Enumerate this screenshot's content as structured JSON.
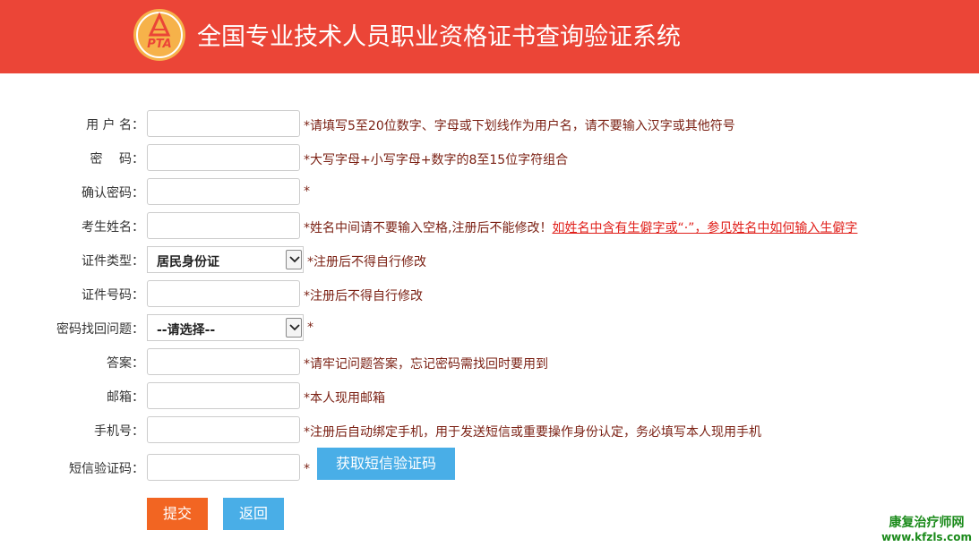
{
  "header": {
    "logo_text": "PTA",
    "title": "全国专业技术人员职业资格证书查询验证系统",
    "bg_color": "#eb4537"
  },
  "form": {
    "username": {
      "label": "用 户 名：",
      "value": "",
      "hint": "*请填写5至20位数字、字母或下划线作为用户名，请不要输入汉字或其他符号"
    },
    "password": {
      "label": "密　 码：",
      "value": "",
      "hint": "*大写字母+小写字母+数字的8至15位字符组合"
    },
    "confirm_password": {
      "label": "确认密码：",
      "value": "",
      "hint": "*"
    },
    "name": {
      "label": "考生姓名：",
      "value": "",
      "hint": "*姓名中间请不要输入空格,注册后不能修改！",
      "hint_link": "如姓名中含有生僻字或“·”，参见姓名中如何输入生僻字"
    },
    "id_type": {
      "label": "证件类型：",
      "selected": "居民身份证",
      "hint": "*注册后不得自行修改"
    },
    "id_number": {
      "label": "证件号码：",
      "value": "",
      "hint": "*注册后不得自行修改"
    },
    "security_question": {
      "label": "密码找回问题：",
      "selected": "--请选择--",
      "hint": "*"
    },
    "answer": {
      "label": "答案：",
      "value": "",
      "hint": "*请牢记问题答案，忘记密码需找回时要用到"
    },
    "email": {
      "label": "邮箱：",
      "value": "",
      "hint": "*本人现用邮箱"
    },
    "phone": {
      "label": "手机号：",
      "value": "",
      "hint": "*注册后自动绑定手机，用于发送短信或重要操作身份认定，务必填写本人现用手机"
    },
    "sms_code": {
      "label": "短信验证码：",
      "value": "",
      "hint": "*",
      "button": "获取短信验证码"
    }
  },
  "actions": {
    "submit": "提交",
    "back": "返回"
  },
  "watermark": {
    "cn": "康复治疗师网",
    "url": "www.kfzls.com"
  },
  "colors": {
    "accent_red": "#eb4537",
    "submit_orange": "#f26522",
    "button_blue": "#49aee7",
    "hint_text": "#7a1f12",
    "link_red": "#e0201b",
    "watermark_green": "#1a8a1a"
  }
}
